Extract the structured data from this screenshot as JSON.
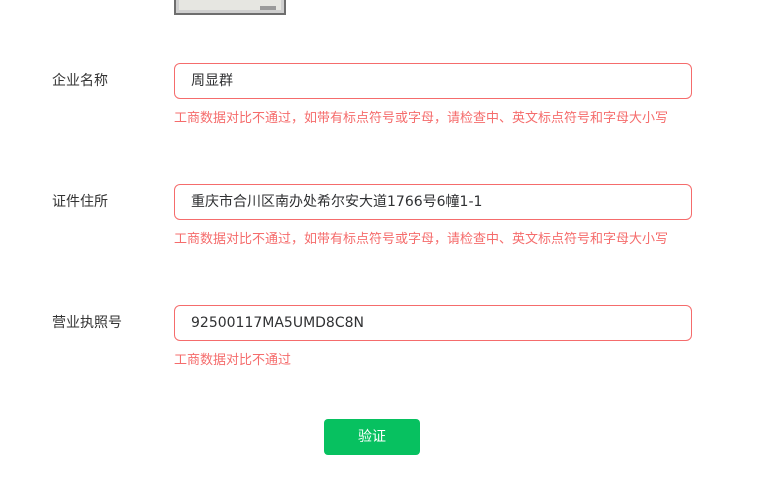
{
  "form": {
    "company_name": {
      "label": "企业名称",
      "value": "周显群",
      "error": "工商数据对比不通过，如带有标点符号或字母，请检查中、英文标点符号和字母大小写"
    },
    "address": {
      "label": "证件住所",
      "value": "重庆市合川区南办处希尔安大道1766号6幢1-1",
      "error": "工商数据对比不通过，如带有标点符号或字母，请检查中、英文标点符号和字母大小写"
    },
    "license_number": {
      "label": "营业执照号",
      "value": "92500117MA5UMD8C8N",
      "error": "工商数据对比不通过"
    }
  },
  "actions": {
    "verify_label": "验证"
  },
  "colors": {
    "error": "#f56c6c",
    "primary": "#07c160"
  }
}
